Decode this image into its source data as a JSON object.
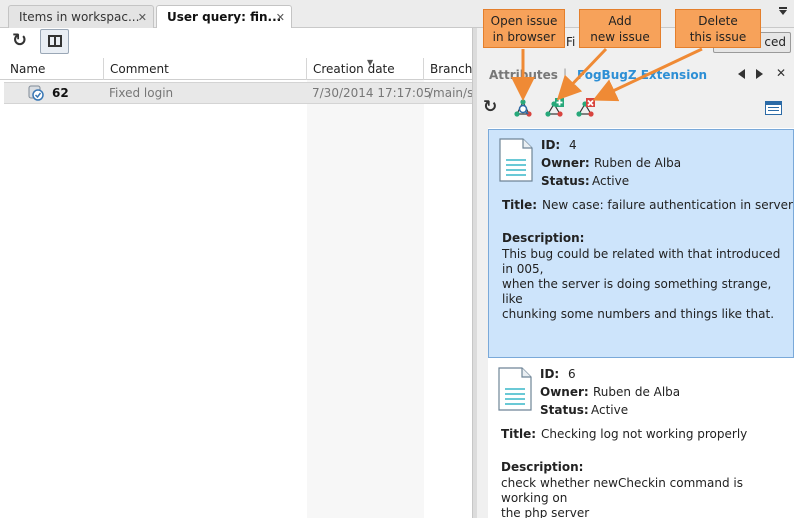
{
  "tabs": [
    {
      "label": "Items in workspac...",
      "close": "✕"
    },
    {
      "label": "User query: fin...",
      "close": "✕"
    }
  ],
  "tab_menu_icon": "chevron-down-icon",
  "filter": {
    "label": "Fi",
    "advanced_label": "ced"
  },
  "table": {
    "columns": [
      "Name",
      "Comment",
      "Creation date",
      "Branch"
    ],
    "rows": [
      {
        "name": "62",
        "comment": "Fixed login",
        "date": "7/30/2014 17:17:05",
        "branch": "/main/s"
      }
    ]
  },
  "panel": {
    "tab_attributes": "Attributes",
    "separator": "|",
    "tab_extension": "FogBugZ Extension",
    "close": "✕"
  },
  "labels": {
    "id": "ID:",
    "owner": "Owner:",
    "status": "Status:",
    "title": "Title:",
    "description": "Description:"
  },
  "issues": [
    {
      "id": "4",
      "owner": "Ruben de Alba",
      "status": "Active",
      "title": "New case: failure authentication in server side",
      "description": "This bug could be related with that introduced in 005,\nwhen the server is doing something strange, like\nchunking some numbers and things like that."
    },
    {
      "id": "6",
      "owner": "Ruben de Alba",
      "status": "Active",
      "title": "Checking log not working properly",
      "description": "check whether newCheckin command is working on\nthe php server"
    }
  ],
  "callouts": {
    "open": "Open issue\nin browser",
    "add": "Add\nnew issue",
    "delete": "Delete\nthis issue"
  },
  "colors": {
    "accent": "#2d8fd5",
    "selected_bg": "#cde4fb",
    "callout": "#f7a25a"
  }
}
